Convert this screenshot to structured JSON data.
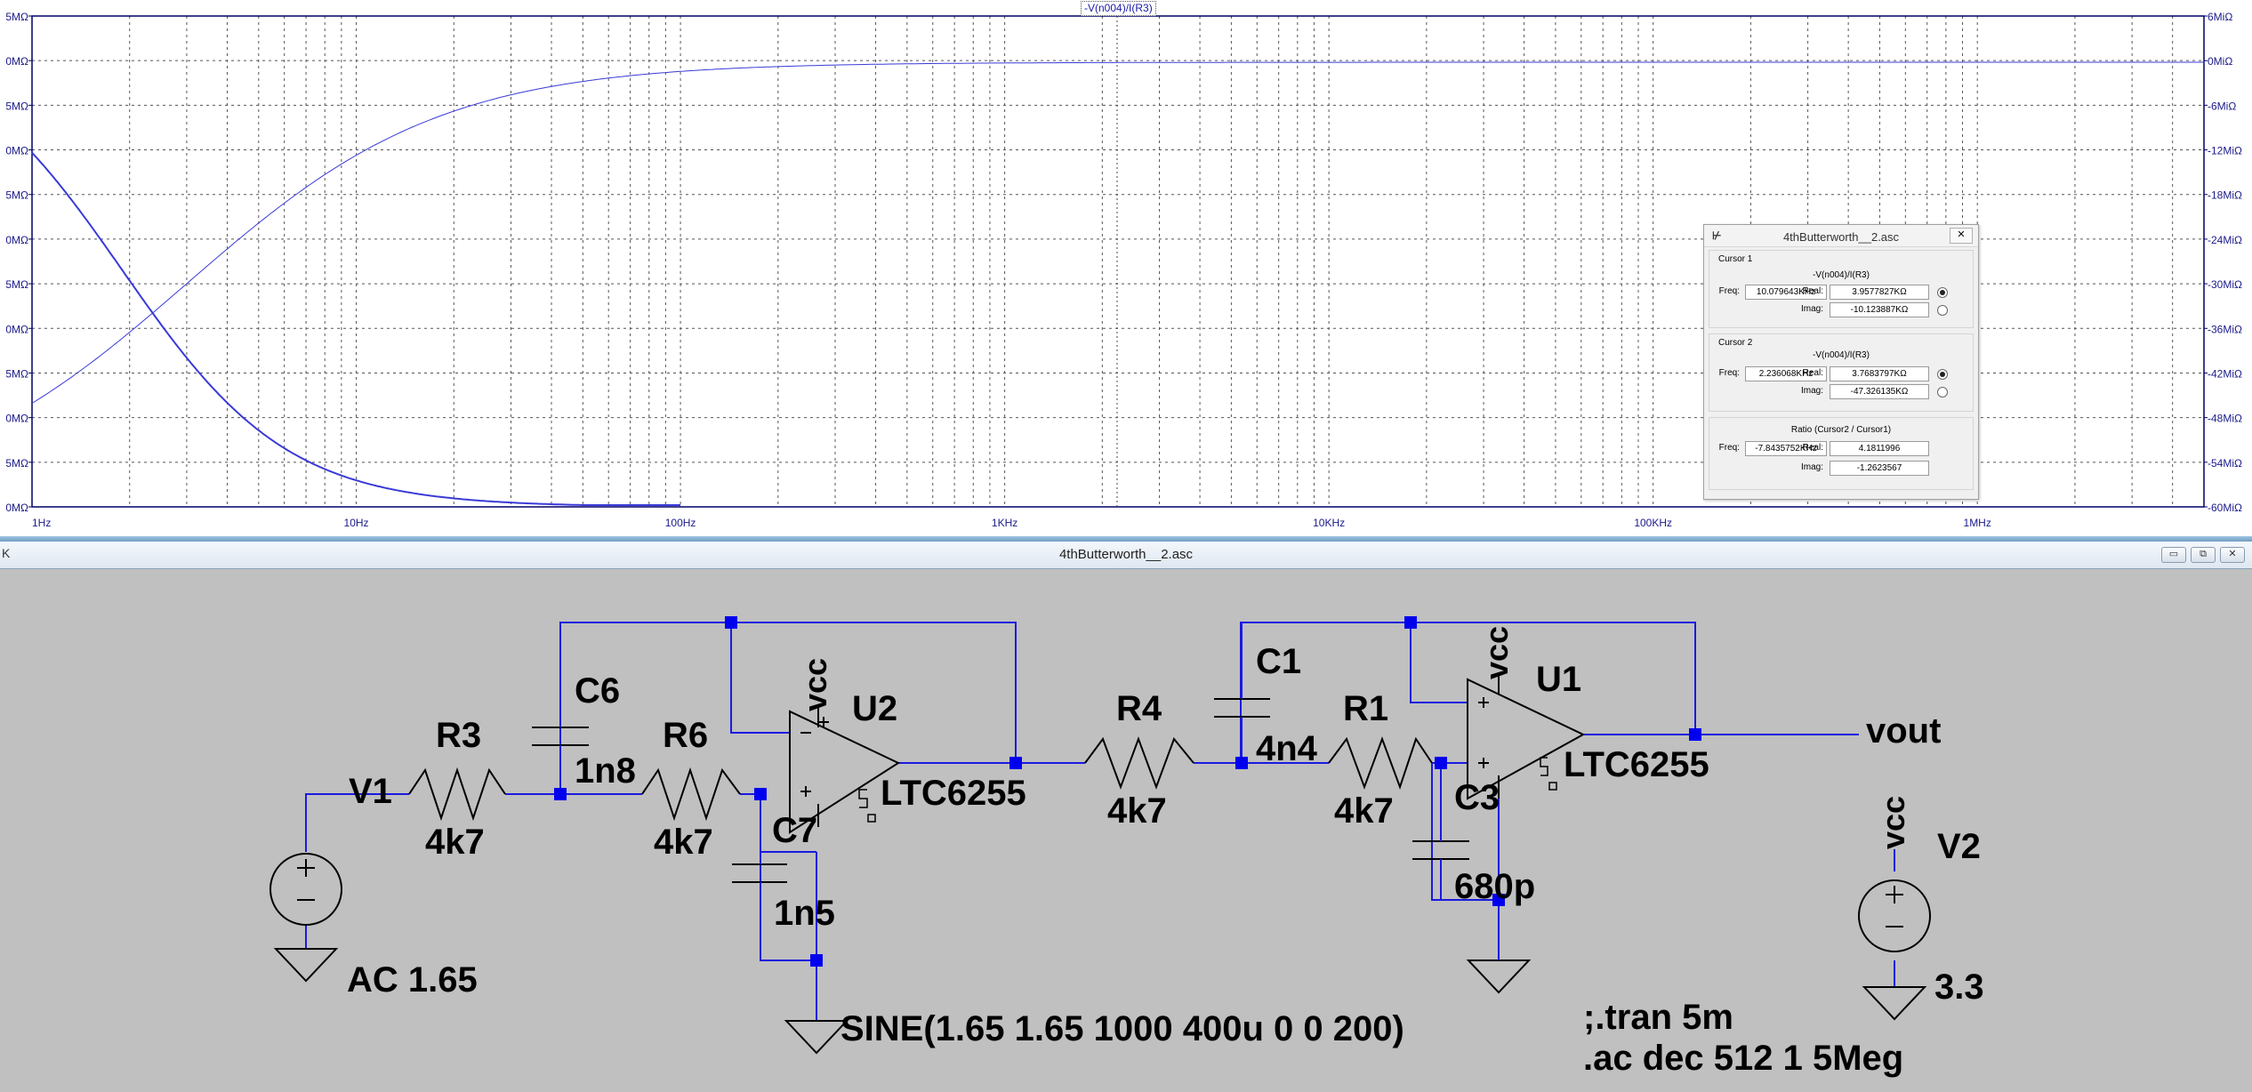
{
  "plot": {
    "trace_label": "-V(n004)/I(R3)",
    "trace_color": "#3a3ad8",
    "left_axis_ticks": [
      "5MΩ",
      "0MΩ",
      "5MΩ",
      "0MΩ",
      "5MΩ",
      "0MΩ",
      "5MΩ",
      "0MΩ",
      "5MΩ",
      "0MΩ",
      "5MΩ",
      "0MΩ"
    ],
    "right_axis_ticks": [
      "6MiΩ",
      "0MiΩ",
      "-6MiΩ",
      "-12MiΩ",
      "-18MiΩ",
      "-24MiΩ",
      "-30MiΩ",
      "-36MiΩ",
      "-42MiΩ",
      "-48MiΩ",
      "-54MiΩ",
      "-60MiΩ"
    ],
    "x_axis_ticks": [
      "1Hz",
      "10Hz",
      "100Hz",
      "1KHz",
      "10KHz",
      "100KHz",
      "1MHz"
    ],
    "x_scale": "log",
    "x_range_hz": [
      1,
      5000000
    ],
    "grid": true
  },
  "cursor_dialog": {
    "title": "4thButterworth__2.asc",
    "close_label": "✕",
    "cursor1": {
      "caption": "Cursor 1",
      "expression": "-V(n004)/I(R3)",
      "freq_label": "Freq:",
      "freq": "10.079643KHz",
      "real_label": "Real:",
      "real": "3.9577827KΩ",
      "imag_label": "Imag:",
      "imag": "-10.123887KΩ"
    },
    "cursor2": {
      "caption": "Cursor 2",
      "expression": "-V(n004)/I(R3)",
      "freq_label": "Freq:",
      "freq": "2.236068KHz",
      "real_label": "Real:",
      "real": "3.7683797KΩ",
      "imag_label": "Imag:",
      "imag": "-47.326135KΩ"
    },
    "ratio": {
      "caption": "Ratio (Cursor2 / Cursor1)",
      "freq_label": "Freq:",
      "freq": "-7.8435752KHz",
      "real_label": "Real:",
      "real": "4.1811996",
      "imag_label": "Imag:",
      "imag": "-1.2623567"
    }
  },
  "schematic_window": {
    "title": "4thButterworth__2.asc",
    "left_glyph": "K",
    "buttons": [
      "▭",
      "⧉",
      "✕"
    ]
  },
  "schematic": {
    "wire_color": "#1a1ae0",
    "V1": {
      "name": "V1",
      "value": "AC 1.65",
      "source": "SINE(1.65 1.65 1000 400u 0 0 200)"
    },
    "V2": {
      "name": "V2",
      "value": "3.3",
      "net": "vcc"
    },
    "R3": {
      "name": "R3",
      "value": "4k7"
    },
    "R6": {
      "name": "R6",
      "value": "4k7"
    },
    "R4": {
      "name": "R4",
      "value": "4k7"
    },
    "R1": {
      "name": "R1",
      "value": "4k7"
    },
    "C6": {
      "name": "C6",
      "value": "1n8"
    },
    "C7": {
      "name": "C7",
      "value": "1n5"
    },
    "C1": {
      "name": "C1",
      "value": "4n4"
    },
    "C3": {
      "name": "C3",
      "value": "680p"
    },
    "U2": {
      "name": "U2",
      "part": "LTC6255",
      "supply": "vcc"
    },
    "U1": {
      "name": "U1",
      "part": "LTC6255",
      "supply": "vcc"
    },
    "output_net": "vout",
    "directives": [
      ";.tran 5m",
      ".ac dec 512 1 5Meg"
    ]
  }
}
